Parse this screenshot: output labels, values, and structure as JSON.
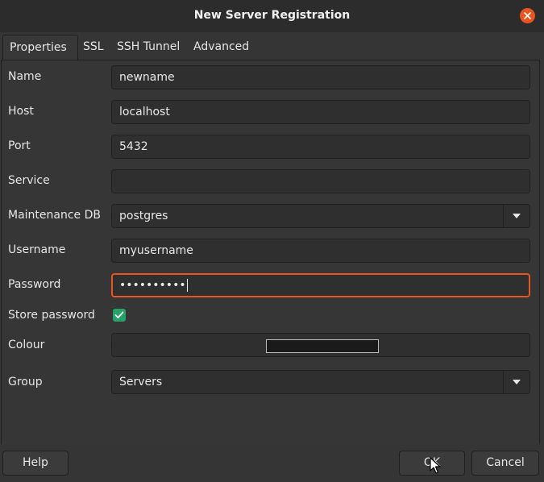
{
  "window": {
    "title": "New Server Registration",
    "accent_color": "#e95420"
  },
  "tabs": [
    {
      "label": "Properties",
      "active": true
    },
    {
      "label": "SSL",
      "active": false
    },
    {
      "label": "SSH Tunnel",
      "active": false
    },
    {
      "label": "Advanced",
      "active": false
    }
  ],
  "form": {
    "name": {
      "label": "Name",
      "value": "newname"
    },
    "host": {
      "label": "Host",
      "value": "localhost"
    },
    "port": {
      "label": "Port",
      "value": "5432"
    },
    "service": {
      "label": "Service",
      "value": ""
    },
    "maintenance_db": {
      "label": "Maintenance DB",
      "value": "postgres"
    },
    "username": {
      "label": "Username",
      "value": "myusername"
    },
    "password": {
      "label": "Password",
      "value": "••••••••••"
    },
    "store_password": {
      "label": "Store password",
      "checked": true
    },
    "colour": {
      "label": "Colour",
      "swatch": "#1a1a1a"
    },
    "group": {
      "label": "Group",
      "value": "Servers"
    }
  },
  "footer": {
    "help_label": "Help",
    "ok_label": "OK",
    "cancel_label": "Cancel"
  }
}
